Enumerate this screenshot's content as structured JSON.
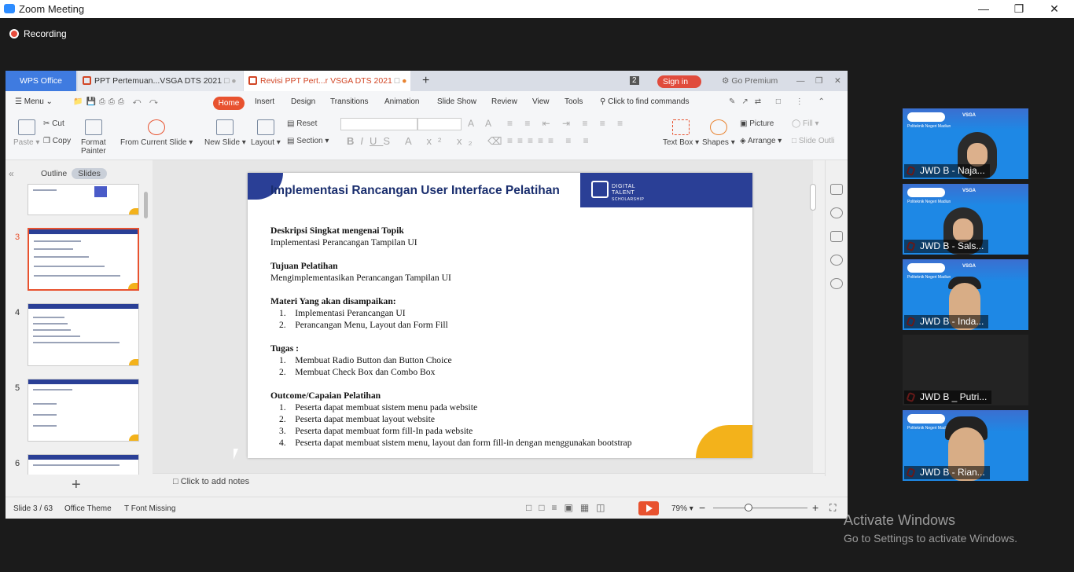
{
  "zoom": {
    "title": "Zoom Meeting",
    "recording": "Recording"
  },
  "wps": {
    "tabs": [
      {
        "label": "WPS Office"
      },
      {
        "label": "PPT Pertemuan...VSGA DTS 2021"
      },
      {
        "label": "Revisi PPT Pert...r VSGA DTS 2021"
      }
    ],
    "tab_count": "2",
    "sign_in": "Sign in",
    "go_premium": "Go Premium",
    "menu": {
      "menu": "Menu",
      "home": "Home",
      "insert": "Insert",
      "design": "Design",
      "transitions": "Transitions",
      "animation": "Animation",
      "slide_show": "Slide Show",
      "review": "Review",
      "view": "View",
      "tools": "Tools",
      "search": "Click to find commands"
    },
    "ribbon": {
      "paste": "Paste",
      "cut": "Cut",
      "copy": "Copy",
      "format_painter_1": "Format",
      "format_painter_2": "Painter",
      "from_current": "From Current Slide",
      "new_slide": "New Slide",
      "layout": "Layout",
      "reset": "Reset",
      "section": "Section",
      "text_box": "Text Box",
      "shapes": "Shapes",
      "picture": "Picture",
      "arrange": "Arrange",
      "fill": "Fill",
      "slide_outline": "Slide Outli"
    },
    "pane": {
      "outline": "Outline",
      "slides": "Slides"
    },
    "thumb_numbers": [
      "3",
      "4",
      "5",
      "6"
    ],
    "slide": {
      "title": "Implementasi Rancangan User Interface Pelatihan",
      "logo_text_1": "DIGITAL",
      "logo_text_2": "TALENT",
      "logo_text_3": "SCHOLARSHIP",
      "sections": [
        {
          "heading": "Deskripsi Singkat mengenai Topik",
          "lines": [
            "Implementasi Perancangan Tampilan UI"
          ]
        },
        {
          "heading": "Tujuan Pelatihan",
          "lines": [
            "Mengimplementasikan Perancangan Tampilan UI"
          ]
        },
        {
          "heading": "Materi Yang akan disampaikan:",
          "items": [
            "1.    Implementasi Perancangan UI",
            "2.    Perancangan Menu, Layout dan Form Fill"
          ]
        },
        {
          "heading": "Tugas :",
          "items": [
            "1.    Membuat Radio Button dan Button Choice",
            "2.    Membuat Check Box dan Combo Box"
          ]
        },
        {
          "heading": "Outcome/Capaian Pelatihan",
          "items": [
            "1.    Peserta dapat membuat sistem menu pada website",
            "2.    Peserta dapat membuat layout website",
            "3.    Peserta dapat membuat form fill-In pada website",
            "4.    Peserta dapat membuat sistem menu, layout dan form fill-in dengan menggunakan bootstrap"
          ]
        }
      ]
    },
    "notes": "Click to add notes",
    "status": {
      "slide": "Slide 3 / 63",
      "theme": "Office Theme",
      "font": "Font Missing",
      "zoom": "79%"
    }
  },
  "participants": [
    {
      "name": "JWD B - Naja..."
    },
    {
      "name": "JWD B - Sals..."
    },
    {
      "name": "JWD B - Inda..."
    },
    {
      "name": "JWD B _ Putri..."
    },
    {
      "name": "JWD B - Rian..."
    }
  ],
  "video_header": {
    "brand": "VSGA",
    "campus": "Politeknik Negeri Madiun"
  },
  "activate": {
    "line1": "Activate Windows",
    "line2": "Go to Settings to activate Windows."
  }
}
